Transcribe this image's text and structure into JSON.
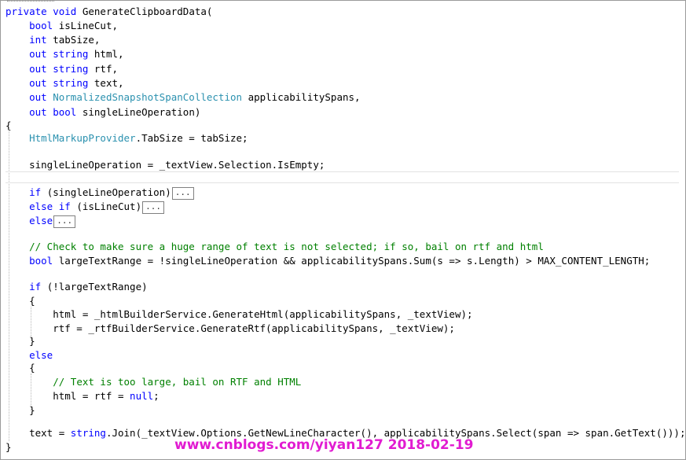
{
  "window": {
    "code_lines": [
      [
        [
          "kw",
          "private"
        ],
        [
          "pl",
          " "
        ],
        [
          "kw",
          "void"
        ],
        [
          "pl",
          " GenerateClipboardData("
        ]
      ],
      [
        [
          "pl",
          "    "
        ],
        [
          "kw",
          "bool"
        ],
        [
          "pl",
          " isLineCut,"
        ]
      ],
      [
        [
          "pl",
          "    "
        ],
        [
          "kw",
          "int"
        ],
        [
          "pl",
          " tabSize,"
        ]
      ],
      [
        [
          "pl",
          "    "
        ],
        [
          "kw",
          "out"
        ],
        [
          "pl",
          " "
        ],
        [
          "kw",
          "string"
        ],
        [
          "pl",
          " html,"
        ]
      ],
      [
        [
          "pl",
          "    "
        ],
        [
          "kw",
          "out"
        ],
        [
          "pl",
          " "
        ],
        [
          "kw",
          "string"
        ],
        [
          "pl",
          " rtf,"
        ]
      ],
      [
        [
          "pl",
          "    "
        ],
        [
          "kw",
          "out"
        ],
        [
          "pl",
          " "
        ],
        [
          "kw",
          "string"
        ],
        [
          "pl",
          " text,"
        ]
      ],
      [
        [
          "pl",
          "    "
        ],
        [
          "kw",
          "out"
        ],
        [
          "pl",
          " "
        ],
        [
          "tp",
          "NormalizedSnapshotSpanCollection"
        ],
        [
          "pl",
          " applicabilitySpans,"
        ]
      ],
      [
        [
          "pl",
          "    "
        ],
        [
          "kw",
          "out"
        ],
        [
          "pl",
          " "
        ],
        [
          "kw",
          "bool"
        ],
        [
          "pl",
          " singleLineOperation)"
        ]
      ],
      [
        [
          "pl",
          "{"
        ]
      ],
      [
        [
          "pl",
          "    "
        ],
        [
          "tp",
          "HtmlMarkupProvider"
        ],
        [
          "pl",
          ".TabSize = tabSize;"
        ]
      ],
      [
        [
          "pl",
          ""
        ]
      ],
      [
        [
          "pl",
          "    singleLineOperation = _textView.Selection.IsEmpty;"
        ]
      ],
      [
        [
          "pl",
          ""
        ]
      ],
      [
        [
          "pl",
          "    "
        ],
        [
          "kw",
          "if"
        ],
        [
          "pl",
          " (singleLineOperation)"
        ],
        [
          "fold",
          "..."
        ]
      ],
      [
        [
          "pl",
          "    "
        ],
        [
          "kw",
          "else if"
        ],
        [
          "pl",
          " (isLineCut)"
        ],
        [
          "fold",
          "..."
        ]
      ],
      [
        [
          "pl",
          "    "
        ],
        [
          "kw",
          "else"
        ],
        [
          "fold",
          "..."
        ]
      ],
      [
        [
          "pl",
          ""
        ]
      ],
      [
        [
          "pl",
          "    "
        ],
        [
          "cm",
          "// Check to make sure a huge range of text is not selected; if so, bail on rtf and html"
        ]
      ],
      [
        [
          "pl",
          "    "
        ],
        [
          "kw",
          "bool"
        ],
        [
          "pl",
          " largeTextRange = !singleLineOperation && applicabilitySpans.Sum(s => s.Length) > MAX_CONTENT_LENGTH;"
        ]
      ],
      [
        [
          "pl",
          ""
        ]
      ],
      [
        [
          "pl",
          "    "
        ],
        [
          "kw",
          "if"
        ],
        [
          "pl",
          " (!largeTextRange)"
        ]
      ],
      [
        [
          "pl",
          "    {"
        ]
      ],
      [
        [
          "pl",
          "        html = _htmlBuilderService.GenerateHtml(applicabilitySpans, _textView);"
        ]
      ],
      [
        [
          "pl",
          "        rtf = _rtfBuilderService.GenerateRtf(applicabilitySpans, _textView);"
        ]
      ],
      [
        [
          "pl",
          "    }"
        ]
      ],
      [
        [
          "pl",
          "    "
        ],
        [
          "kw",
          "else"
        ]
      ],
      [
        [
          "pl",
          "    {"
        ]
      ],
      [
        [
          "pl",
          "        "
        ],
        [
          "cm",
          "// Text is too large, bail on RTF and HTML"
        ]
      ],
      [
        [
          "pl",
          "        html = rtf = "
        ],
        [
          "kw",
          "null"
        ],
        [
          "pl",
          ";"
        ]
      ],
      [
        [
          "pl",
          "    }"
        ]
      ],
      [
        [
          "pl",
          ""
        ]
      ],
      [
        [
          "pl",
          "    text = "
        ],
        [
          "kw",
          "string"
        ],
        [
          "pl",
          ".Join(_textView.Options.GetNewLineCharacter(), applicabilitySpans.Select(span => span.GetText()));"
        ]
      ],
      [
        [
          "pl",
          "}"
        ]
      ]
    ]
  },
  "watermark": {
    "text": "www.cnblogs.com/yiyan127 2018-02-19"
  },
  "colors": {
    "keyword": "#0000ff",
    "type": "#2b91af",
    "comment": "#008000",
    "watermark": "#e11bd1"
  }
}
